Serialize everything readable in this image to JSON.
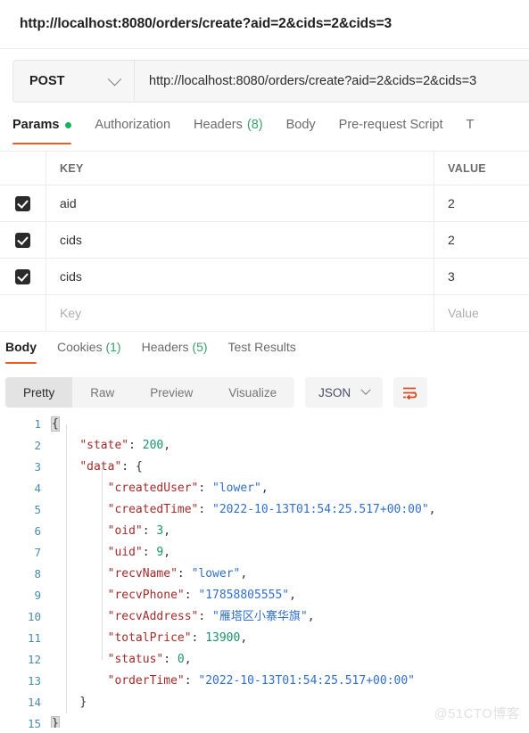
{
  "window": {
    "title_url": "http://localhost:8080/orders/create?aid=2&cids=2&cids=3"
  },
  "request": {
    "method": "POST",
    "url": "http://localhost:8080/orders/create?aid=2&cids=2&cids=3",
    "tabs": [
      {
        "label": "Params",
        "active": true,
        "has_dot": true
      },
      {
        "label": "Authorization",
        "active": false
      },
      {
        "label": "Headers",
        "count": "(8)",
        "active": false
      },
      {
        "label": "Body",
        "active": false
      },
      {
        "label": "Pre-request Script",
        "active": false
      },
      {
        "label": "T",
        "active": false
      }
    ],
    "params_table": {
      "headers": {
        "key": "KEY",
        "value": "VALUE"
      },
      "rows": [
        {
          "checked": true,
          "key": "aid",
          "value": "2"
        },
        {
          "checked": true,
          "key": "cids",
          "value": "2"
        },
        {
          "checked": true,
          "key": "cids",
          "value": "3"
        }
      ],
      "placeholder_row": {
        "key": "Key",
        "value": "Value"
      }
    }
  },
  "response": {
    "tabs": [
      {
        "label": "Body",
        "active": true
      },
      {
        "label": "Cookies",
        "count": "(1)",
        "active": false
      },
      {
        "label": "Headers",
        "count": "(5)",
        "active": false
      },
      {
        "label": "Test Results",
        "active": false
      }
    ],
    "view_modes": [
      {
        "label": "Pretty",
        "active": true
      },
      {
        "label": "Raw",
        "active": false
      },
      {
        "label": "Preview",
        "active": false
      },
      {
        "label": "Visualize",
        "active": false
      }
    ],
    "format": "JSON",
    "wrap_icon": "word-wrap-icon",
    "body_lines": [
      {
        "n": "1",
        "segments": [
          {
            "t": "brace",
            "v": "{"
          }
        ]
      },
      {
        "n": "2",
        "indent": 4,
        "segments": [
          {
            "t": "key",
            "v": "\"state\""
          },
          {
            "t": "punc",
            "v": ": "
          },
          {
            "t": "num",
            "v": "200"
          },
          {
            "t": "punc",
            "v": ","
          }
        ]
      },
      {
        "n": "3",
        "indent": 4,
        "segments": [
          {
            "t": "key",
            "v": "\"data\""
          },
          {
            "t": "punc",
            "v": ": "
          },
          {
            "t": "punc",
            "v": "{"
          }
        ]
      },
      {
        "n": "4",
        "indent": 8,
        "segments": [
          {
            "t": "key",
            "v": "\"createdUser\""
          },
          {
            "t": "punc",
            "v": ": "
          },
          {
            "t": "str",
            "v": "\"lower\""
          },
          {
            "t": "punc",
            "v": ","
          }
        ]
      },
      {
        "n": "5",
        "indent": 8,
        "segments": [
          {
            "t": "key",
            "v": "\"createdTime\""
          },
          {
            "t": "punc",
            "v": ": "
          },
          {
            "t": "str",
            "v": "\"2022-10-13T01:54:25.517+00:00\""
          },
          {
            "t": "punc",
            "v": ","
          }
        ]
      },
      {
        "n": "6",
        "indent": 8,
        "segments": [
          {
            "t": "key",
            "v": "\"oid\""
          },
          {
            "t": "punc",
            "v": ": "
          },
          {
            "t": "num",
            "v": "3"
          },
          {
            "t": "punc",
            "v": ","
          }
        ]
      },
      {
        "n": "7",
        "indent": 8,
        "segments": [
          {
            "t": "key",
            "v": "\"uid\""
          },
          {
            "t": "punc",
            "v": ": "
          },
          {
            "t": "num",
            "v": "9"
          },
          {
            "t": "punc",
            "v": ","
          }
        ]
      },
      {
        "n": "8",
        "indent": 8,
        "segments": [
          {
            "t": "key",
            "v": "\"recvName\""
          },
          {
            "t": "punc",
            "v": ": "
          },
          {
            "t": "str",
            "v": "\"lower\""
          },
          {
            "t": "punc",
            "v": ","
          }
        ]
      },
      {
        "n": "9",
        "indent": 8,
        "segments": [
          {
            "t": "key",
            "v": "\"recvPhone\""
          },
          {
            "t": "punc",
            "v": ": "
          },
          {
            "t": "str",
            "v": "\"17858805555\""
          },
          {
            "t": "punc",
            "v": ","
          }
        ]
      },
      {
        "n": "10",
        "indent": 8,
        "segments": [
          {
            "t": "key",
            "v": "\"recvAddress\""
          },
          {
            "t": "punc",
            "v": ": "
          },
          {
            "t": "str",
            "v": "\"雁塔区小寨华旗\""
          },
          {
            "t": "punc",
            "v": ","
          }
        ]
      },
      {
        "n": "11",
        "indent": 8,
        "segments": [
          {
            "t": "key",
            "v": "\"totalPrice\""
          },
          {
            "t": "punc",
            "v": ": "
          },
          {
            "t": "num",
            "v": "13900"
          },
          {
            "t": "punc",
            "v": ","
          }
        ]
      },
      {
        "n": "12",
        "indent": 8,
        "segments": [
          {
            "t": "key",
            "v": "\"status\""
          },
          {
            "t": "punc",
            "v": ": "
          },
          {
            "t": "num",
            "v": "0"
          },
          {
            "t": "punc",
            "v": ","
          }
        ]
      },
      {
        "n": "13",
        "indent": 8,
        "segments": [
          {
            "t": "key",
            "v": "\"orderTime\""
          },
          {
            "t": "punc",
            "v": ": "
          },
          {
            "t": "str",
            "v": "\"2022-10-13T01:54:25.517+00:00\""
          }
        ]
      },
      {
        "n": "14",
        "indent": 4,
        "segments": [
          {
            "t": "punc",
            "v": "}"
          }
        ]
      },
      {
        "n": "15",
        "segments": [
          {
            "t": "brace",
            "v": "}"
          }
        ]
      }
    ]
  },
  "watermark": "@51CTO博客",
  "colors": {
    "accent": "#ef5b25",
    "count_green": "#3aa06a",
    "dot_green": "#16b45c",
    "json_key": "#a52a2a",
    "json_string": "#2f6fce",
    "json_number": "#1a9166",
    "line_number": "#4a8ba8",
    "checkbox": "#2b2b2b"
  }
}
